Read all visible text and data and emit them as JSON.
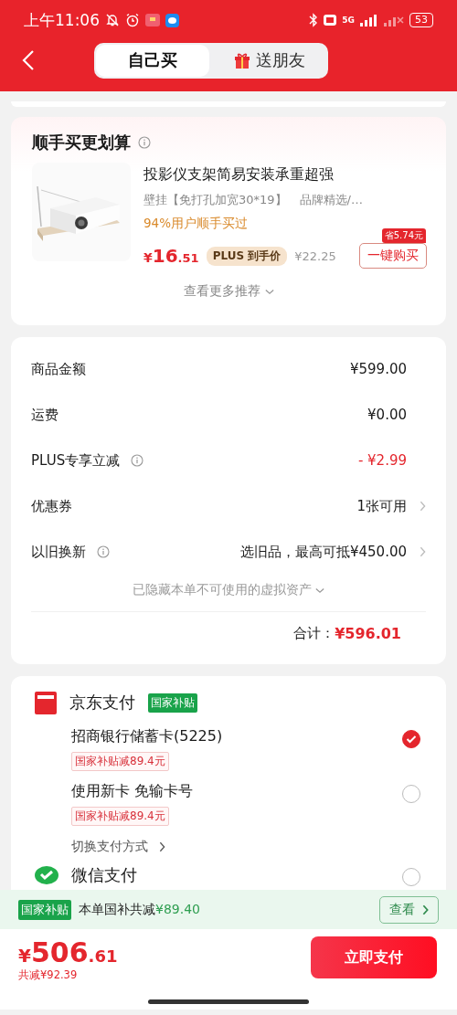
{
  "status_bar": {
    "time": "上午11:06",
    "network": "5G",
    "battery": "53"
  },
  "tabs": [
    {
      "label": "自己买",
      "selected": true,
      "kind": "plain"
    },
    {
      "label": "送朋友",
      "selected": false,
      "kind": "gift"
    }
  ],
  "bundle": {
    "title": "顺手买更划算",
    "product": {
      "kind": "picture",
      "title": "投影仪支架简易安装承重超强",
      "spec": "壁挂【免打孔加宽30*19】",
      "brand": "品牌精选/…",
      "social": "94%用户顺手买过",
      "price_symbol": "¥",
      "price_main": "16",
      "price_cents": ".51",
      "plus_badge": "PLUS 到手价",
      "original_price": "¥22.25",
      "buy_button": "一键购买",
      "save_tag": "省5.74元"
    },
    "more": "查看更多推荐"
  },
  "summary": {
    "rows": [
      {
        "label": "商品金额",
        "value": "¥599.00",
        "kind": "plain",
        "info": false
      },
      {
        "label": "运费",
        "value": "¥0.00",
        "kind": "plain",
        "info": false
      },
      {
        "label": "PLUS专享立减",
        "value": "- ¥2.99",
        "kind": "discount",
        "info": true
      },
      {
        "label": "优惠券",
        "value": "1张可用",
        "kind": "link",
        "info": false
      },
      {
        "label": "以旧换新",
        "value": "选旧品，最高可抵¥450.00",
        "kind": "link",
        "info": true
      }
    ],
    "hidden_note": "已隐藏本单不可使用的虚拟资产",
    "total_label": "合计：",
    "total": "¥596.01"
  },
  "payment": {
    "methods": [
      {
        "name": "京东支付",
        "kind": "jdpay",
        "badge": "国家补贴",
        "options": [
          {
            "label": "招商银行储蓄卡(5225)",
            "tag": "国家补贴减89.4元",
            "selected": true
          },
          {
            "label": "使用新卡 免输卡号",
            "tag": "国家补贴减89.4元",
            "selected": false
          }
        ],
        "switch_link": "切换支付方式"
      },
      {
        "name": "微信支付",
        "kind": "wechat",
        "selected": false
      }
    ]
  },
  "subsidy_bar": {
    "badge": "国家补贴",
    "text": "本单国补共减",
    "amount": "¥89.40",
    "button": "查看"
  },
  "checkout": {
    "price_symbol": "¥",
    "price_main": "506",
    "price_cents": ".61",
    "saved": "共减¥92.39",
    "pay_button": "立即支付"
  }
}
